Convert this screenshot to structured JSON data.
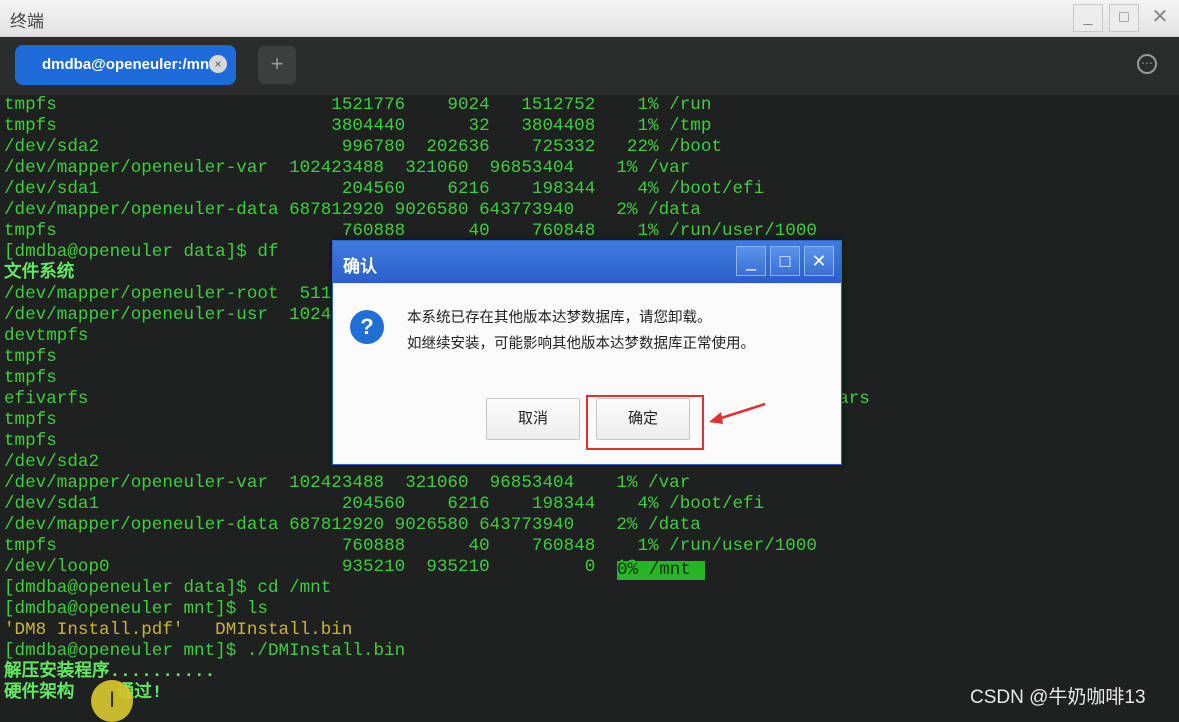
{
  "window": {
    "title": "终端"
  },
  "tab": {
    "label": "dmdba@openeuler:/mnt",
    "close": "×"
  },
  "add_tab": "+",
  "menu_icon": "⋯",
  "terminal": {
    "lines": [
      "tmpfs                          1521776    9024   1512752    1% /run",
      "tmpfs                          3804440      32   3804408    1% /tmp",
      "/dev/sda2                       996780  202636    725332   22% /boot",
      "/dev/mapper/openeuler-var  102423488  321060  96853404    1% /var",
      "/dev/sda1                       204560    6216    198344    4% /boot/efi",
      "/dev/mapper/openeuler-data 687812920 9026580 643773940    2% /data",
      "tmpfs                           760888      40    760848    1% /run/user/1000",
      "[dmdba@openeuler data]$ df",
      "文件系统",
      "/dev/mapper/openeuler-root  511",
      "/dev/mapper/openeuler-usr  1024",
      "devtmpfs",
      "tmpfs                          38",
      "tmpfs",
      "efivarfs                                                                   efivars",
      "tmpfs                          15",
      "tmpfs                          38",
      "/dev/sda2",
      "/dev/mapper/openeuler-var  102423488  321060  96853404    1% /var",
      "/dev/sda1                       204560    6216    198344    4% /boot/efi",
      "/dev/mapper/openeuler-data 687812920 9026580 643773940    2% /data",
      "tmpfs                           760888      40    760848    1% /run/user/1000",
      "/dev/loop0                      935210  935210         0  10",
      "[dmdba@openeuler data]$ cd /mnt",
      "[dmdba@openeuler mnt]$ ls",
      "'DM8 Install.pdf'   DMInstall.bin",
      "[dmdba@openeuler mnt]$ ./DMInstall.bin",
      "解压安装程序..........",
      "硬件架构    通过!"
    ],
    "loop_highlight": "0% /mnt",
    "cursor": "I"
  },
  "dialog": {
    "title": "确认",
    "minimize": "_",
    "maximize": "□",
    "close": "✕",
    "message_line1": "本系统已存在其他版本达梦数据库，请您卸载。",
    "message_line2": "如继续安装，可能影响其他版本达梦数据库正常使用。",
    "cancel_label": "取消",
    "ok_label": "确定"
  },
  "watermark": "CSDN @牛奶咖啡13",
  "colors": {
    "terminal_bg": "#1f2121",
    "terminal_text": "#3ccf3c",
    "tab_active": "#1d6ad8",
    "dialog_title": "#2a5fc9",
    "annotation_red": "#e03030"
  }
}
